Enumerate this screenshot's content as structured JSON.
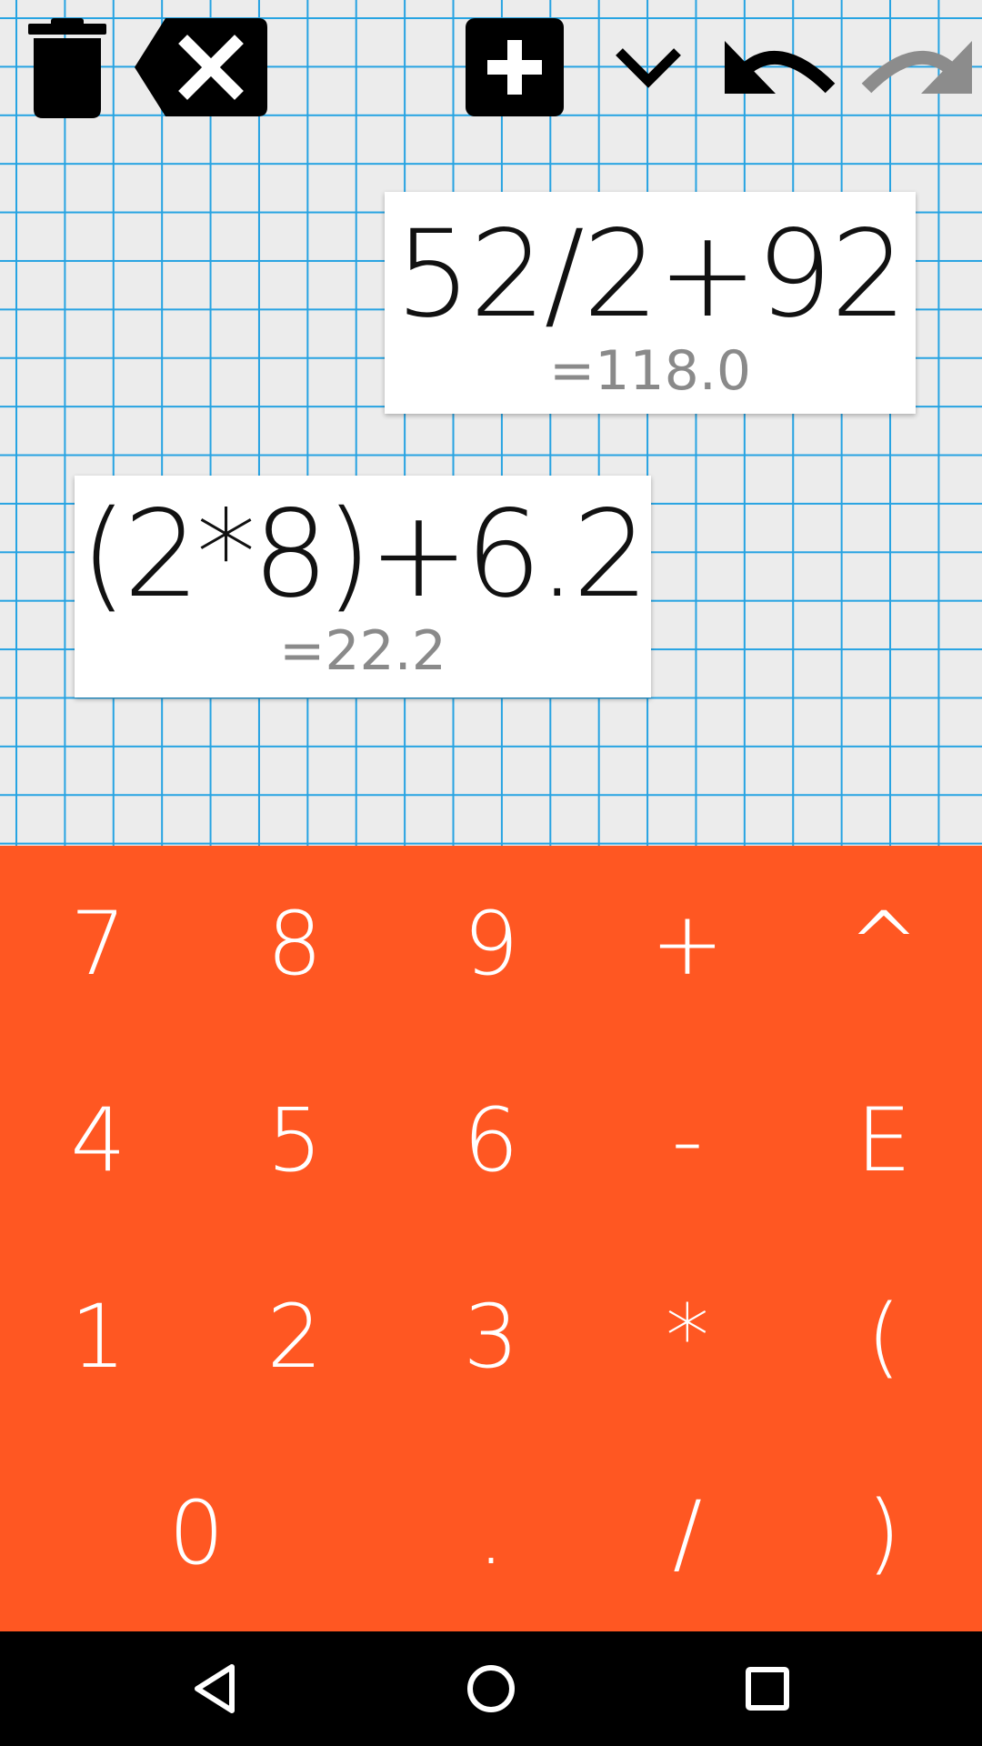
{
  "toolbar": {
    "icons": [
      "trash-icon",
      "backspace-icon",
      "add-box-icon",
      "chevron-down-icon",
      "undo-icon",
      "redo-icon"
    ]
  },
  "cards": [
    {
      "expression": "52/2+92",
      "result": "=118.0"
    },
    {
      "expression": "(2*8)+6.2",
      "result": "=22.2"
    }
  ],
  "keypad": {
    "rows": [
      [
        "7",
        "8",
        "9",
        "+",
        "^"
      ],
      [
        "4",
        "5",
        "6",
        "-",
        "E"
      ],
      [
        "1",
        "2",
        "3",
        "*",
        "("
      ],
      [
        "0",
        ".",
        "/",
        ")"
      ]
    ]
  },
  "navbar": {
    "icons": [
      "back-icon",
      "home-icon",
      "recents-icon"
    ]
  },
  "colors": {
    "keypad_bg": "#ff5722",
    "grid_line": "#26a3e2",
    "canvas_bg": "#ececec",
    "result_text": "#8a8a8a",
    "navbar_bg": "#000000",
    "redo_disabled": "#8c8c8c"
  }
}
